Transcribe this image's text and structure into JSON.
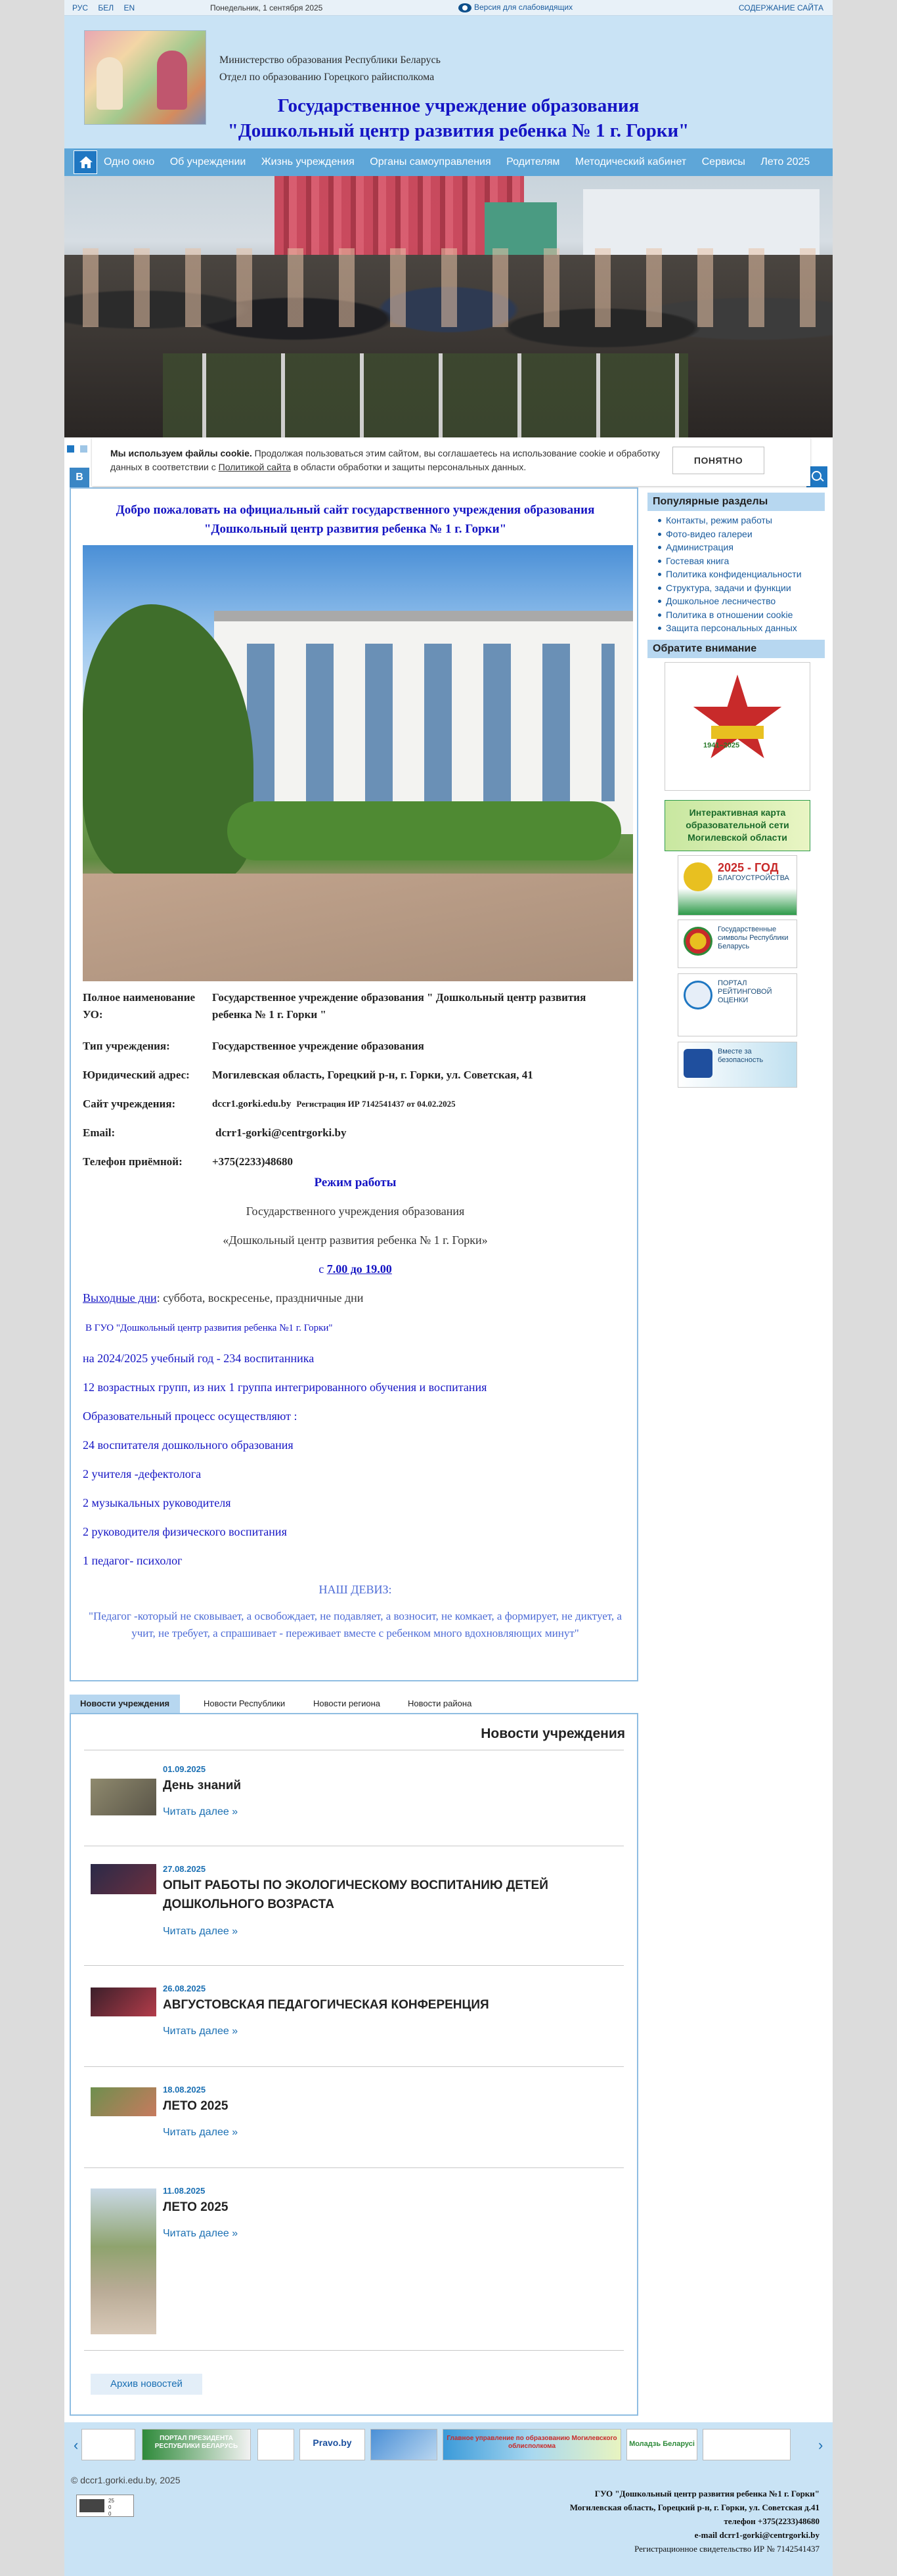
{
  "topbar": {
    "langs": [
      "РУС",
      "БЕЛ",
      "EN"
    ],
    "date": "Понедельник, 1 сентября 2025",
    "vision_label": "Версия для слабовидящих",
    "sitemap_label": "СОДЕРЖАНИЕ САЙТА"
  },
  "header": {
    "ministry_line1": "Министерство образования Республики Беларусь",
    "ministry_line2": "Отдел по образованию Горецкого райисполкома",
    "title_line1": "Государственное учреждение образования",
    "title_line2": "\"Дошкольный центр развития ребенка № 1 г. Горки\""
  },
  "nav": {
    "items": [
      "Одно окно",
      "Об учреждении",
      "Жизнь учреждения",
      "Органы самоуправления",
      "Родителям",
      "Методический кабинет",
      "Сервисы",
      "Лето 2025"
    ]
  },
  "cookie": {
    "bold": "Мы используем файлы cookie.",
    "text1": " Продолжая пользоваться этим сайтом, вы соглашаетесь на использование cookie и обработку данных в соответствии с ",
    "link": "Политикой сайта",
    "text2": " в области обработки и защиты персональных данных.",
    "button": "ПОНЯТНО"
  },
  "main": {
    "tab_letter": "В",
    "welcome_line1": "Добро пожаловать на официальный сайт государственного учреждения образования",
    "welcome_line2": "\"Дошкольный центр развития ребенка № 1 г. Горки\"",
    "info": {
      "fullname_label": "Полное наименование УО:",
      "fullname_value": "Государственное учреждение образования \" Дошкольный центр развития ребенка № 1 г. Горки \"",
      "type_label": "Тип учреждения:",
      "type_value": "Государственное учреждение образования",
      "address_label": "Юридический адрес:",
      "address_value": "Могилевская область, Горецкий р-н, г. Горки, ул. Советская, 41",
      "site_label": "Сайт учреждения:",
      "site_value": "dccr1.gorki.edu.by",
      "site_reg": "Регистрация ИР 7142541437 от 04.02.2025",
      "email_label": "Email:",
      "email_value": "dcrr1-gorki@centrgorki.by",
      "phone_label": "Телефон приёмной:",
      "phone_value": "+375(2233)48680"
    },
    "schedule": {
      "title": "Режим работы",
      "line1": "Государственного учреждения образования",
      "line2": "«Дошкольный центр развития ребенка № 1 г. Горки»",
      "hours_prefix": "с ",
      "hours": "7.00 до 19.00",
      "days_off_label": "Выходные дни",
      "days_off_value": ": суббота, воскресенье, праздничные дни",
      "inst": "В ГУО  \"Дошкольный центр развития ребенка №1 г. Горки\"",
      "year": "на 2024/2025 учебный год - 234 воспитанника",
      "groups": "12 возрастных групп, из них 1 группа интегрированного обучения и воспитания",
      "process": "Образовательный процесс осуществляют :",
      "staff1": "24 воспитателя дошкольного образования",
      "staff2": "2 учителя -дефектолога",
      "staff3": "2 музыкальных руководителя",
      "staff4": "2 руководителя физического воспитания",
      "staff5": "1 педагог- психолог",
      "motto_title": "НАШ ДЕВИЗ:",
      "motto": "\"Педагог  -который не сковывает, а освобождает, не подавляет, а возносит, не комкает, а формирует, не диктует, а учит, не требует, а спрашивает - переживает вместе  с ребенком много вдохновляющих минут\""
    }
  },
  "news": {
    "tabs": [
      "Новости учреждения",
      "Новости Республики",
      "Новости региона",
      "Новости района"
    ],
    "heading": "Новости учреждения",
    "items": [
      {
        "date": "01.09.2025",
        "title": "День знаний",
        "more": "Читать далее »"
      },
      {
        "date": "27.08.2025",
        "title": "ОПЫТ РАБОТЫ ПО ЭКОЛОГИЧЕСКОМУ ВОСПИТАНИЮ ДЕТЕЙ ДОШКОЛЬНОГО ВОЗРАСТА",
        "more": "Читать далее »"
      },
      {
        "date": "26.08.2025",
        "title": "АВГУСТОВСКАЯ ПЕДАГОГИЧЕСКАЯ КОНФЕРЕНЦИЯ",
        "more": "Читать далее »"
      },
      {
        "date": "18.08.2025",
        "title": "ЛЕТО 2025",
        "more": "Читать далее »"
      },
      {
        "date": "11.08.2025",
        "title": "ЛЕТО 2025",
        "more": "Читать далее »"
      }
    ],
    "archive": "Архив новостей"
  },
  "sidebar": {
    "popular_title": "Популярные разделы",
    "popular": [
      "Контакты, режим работы",
      "Фото-видео галереи",
      "Администрация",
      "Гостевая книга",
      "Политика конфиденциальности",
      "Структура, задачи и функции",
      "Дошкольное лесничество",
      "Политика в отношении cookie",
      "Защита персональных данных"
    ],
    "attention_title": "Обратите внимание",
    "star_years": "1941–2025",
    "map_banner_line1": "Интерактивная карта",
    "map_banner_line2": "образовательной сети",
    "map_banner_line3": "Могилевской области",
    "banner_year_big": "2025 - ГОД",
    "banner_year_small": "БЛАГОУСТРОЙСТВА",
    "banner_symbols": "Государственные символы Республики Беларусь",
    "banner_portal": "ПОРТАЛ РЕЙТИНГОВОЙ ОЦЕНКИ",
    "banner_safety": "Вместе за безопасность"
  },
  "partners": {
    "prev": "‹",
    "next": "›",
    "pravo": "Pravo.by",
    "portal_president": "ПОРТАЛ ПРЕЗИДЕНТА РЕСПУБЛИКИ БЕЛАРУСЬ",
    "mogilev": "Главное управление по образованию Могилевского облисполкома",
    "youth": "Моладзь Беларусі"
  },
  "footer": {
    "copyright": "© dccr1.gorki.edu.by, 2025",
    "addr1": "ГУО \"Дошкольный центр развития ребенка №1 г. Горки\"",
    "addr2": "Могилевская область, Горецкий р-н, г. Горки, ул. Советская д.41",
    "addr3": "телефон +375(2233)48680",
    "addr4": "e-mail dcrr1-gorki@centrgorki.by",
    "addr5": "Регистрационное свидетельство ИР № 7142541437"
  },
  "colors": {
    "accent": "#1f77c2",
    "title_blue": "#1515c4",
    "header_bg": "#c9e3f5",
    "nav_bg": "#5ea6d8"
  }
}
